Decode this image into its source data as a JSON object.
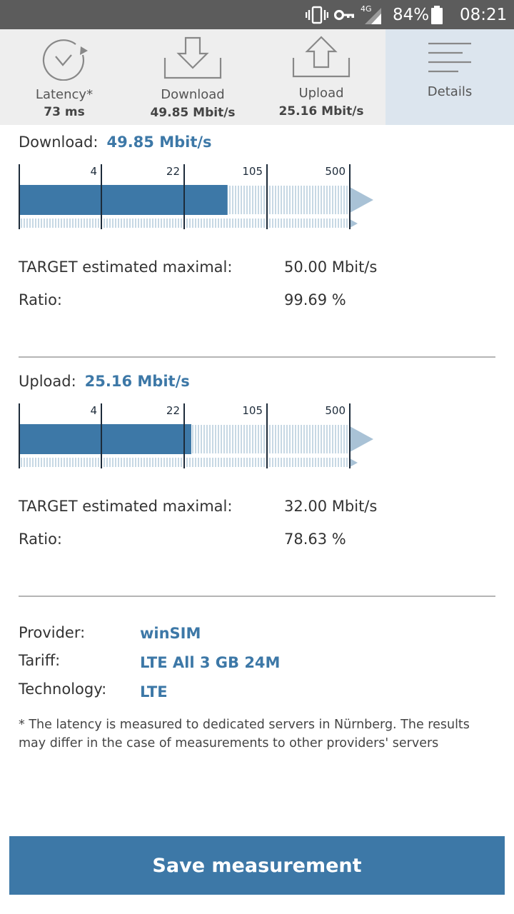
{
  "status_bar": {
    "network": "4G",
    "battery": "84%",
    "time": "08:21",
    "icons": [
      "vibrate-icon",
      "vpn-key-icon",
      "signal-icon",
      "battery-icon"
    ]
  },
  "tabs": [
    {
      "label": "Latency*",
      "value": "73 ms",
      "icon": "latency-gauge-icon"
    },
    {
      "label": "Download",
      "value": "49.85 Mbit/s",
      "icon": "download-tray-icon"
    },
    {
      "label": "Upload",
      "value": "25.16 Mbit/s",
      "icon": "upload-tray-icon"
    },
    {
      "label": "Details",
      "value": "",
      "icon": "menu-lines-icon",
      "active": true
    }
  ],
  "download": {
    "title": "Download:",
    "speed": "49.85 Mbit/s",
    "speed_value": 49.85,
    "scale_ticks": [
      "4",
      "22",
      "105",
      "500"
    ],
    "target_label": "TARGET estimated maximal:",
    "target_value": "50.00 Mbit/s",
    "ratio_label": "Ratio:",
    "ratio_value": "99.69 %"
  },
  "upload": {
    "title": "Upload:",
    "speed": "25.16 Mbit/s",
    "speed_value": 25.16,
    "scale_ticks": [
      "4",
      "22",
      "105",
      "500"
    ],
    "target_label": "TARGET estimated maximal:",
    "target_value": "32.00 Mbit/s",
    "ratio_label": "Ratio:",
    "ratio_value": "78.63 %"
  },
  "info": {
    "provider_label": "Provider:",
    "provider_value": "winSIM",
    "tariff_label": "Tariff:",
    "tariff_value": "LTE All 3 GB 24M",
    "technology_label": "Technology:",
    "technology_value": "LTE"
  },
  "note": "* The latency is measured to dedicated servers in Nürnberg. The results may differ in the case of measurements to other providers' servers",
  "save_button": "Save measurement",
  "colors": {
    "accent": "#3d78a7",
    "status_bar": "#5c5c5c",
    "tabbar": "#eeeeee",
    "tab_active": "#dce5ee"
  }
}
